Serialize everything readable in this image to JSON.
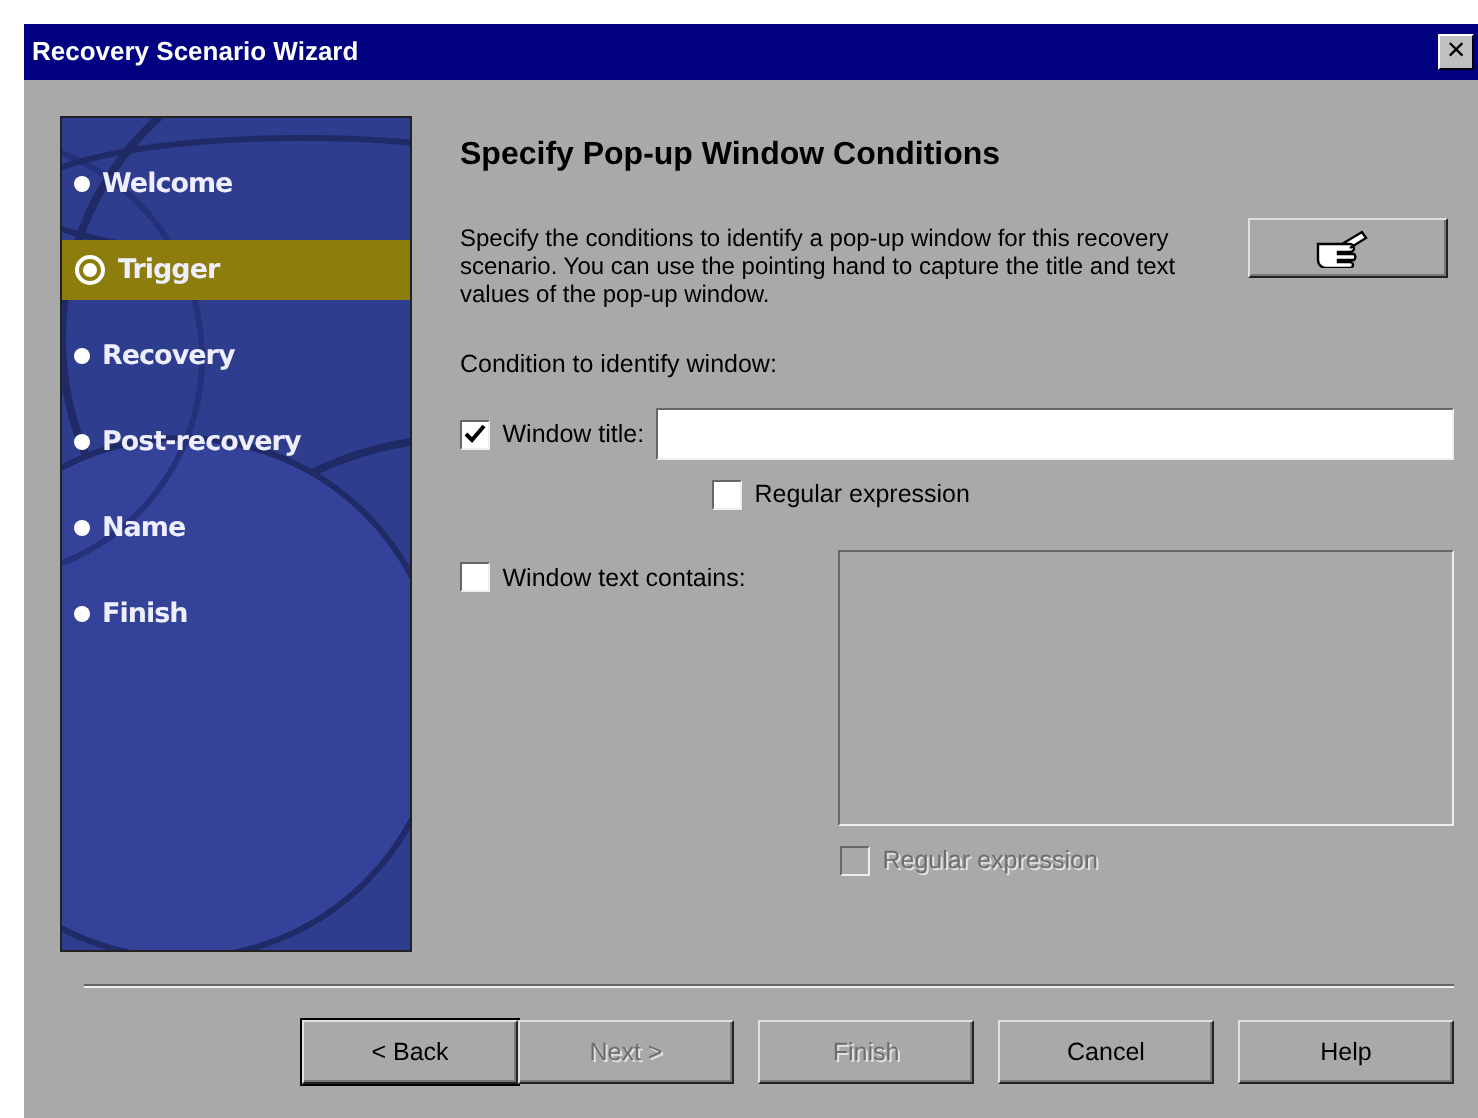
{
  "window": {
    "title": "Recovery Scenario Wizard",
    "close": "×"
  },
  "sidebar": {
    "items": [
      {
        "label": "Welcome",
        "selected": false
      },
      {
        "label": "Trigger",
        "selected": true
      },
      {
        "label": "Recovery",
        "selected": false
      },
      {
        "label": "Post-recovery",
        "selected": false
      },
      {
        "label": "Name",
        "selected": false
      },
      {
        "label": "Finish",
        "selected": false
      }
    ]
  },
  "heading": "Specify Pop-up Window Conditions",
  "description": "Specify the conditions to identify a pop-up window for this recovery scenario. You can use the pointing hand to capture the title and text values of the pop-up window.",
  "condition_label": "Condition to identify window:",
  "window_title": {
    "label": "Window title:",
    "checked": true,
    "regex": {
      "label": "Regular expression",
      "checked": false,
      "disabled": false
    }
  },
  "window_text": {
    "label": "Window text contains:",
    "checked": false,
    "disabled": true,
    "regex": {
      "label": "Regular expression",
      "checked": false,
      "disabled": true
    }
  },
  "buttons": [
    {
      "label": "< Back",
      "disabled": false,
      "default": true
    },
    {
      "label": "Next >",
      "disabled": true,
      "default": false
    },
    {
      "label": "Finish",
      "disabled": true,
      "default": false
    },
    {
      "label": "Cancel",
      "disabled": false,
      "default": false
    },
    {
      "label": "Help",
      "disabled": false,
      "default": false
    }
  ]
}
